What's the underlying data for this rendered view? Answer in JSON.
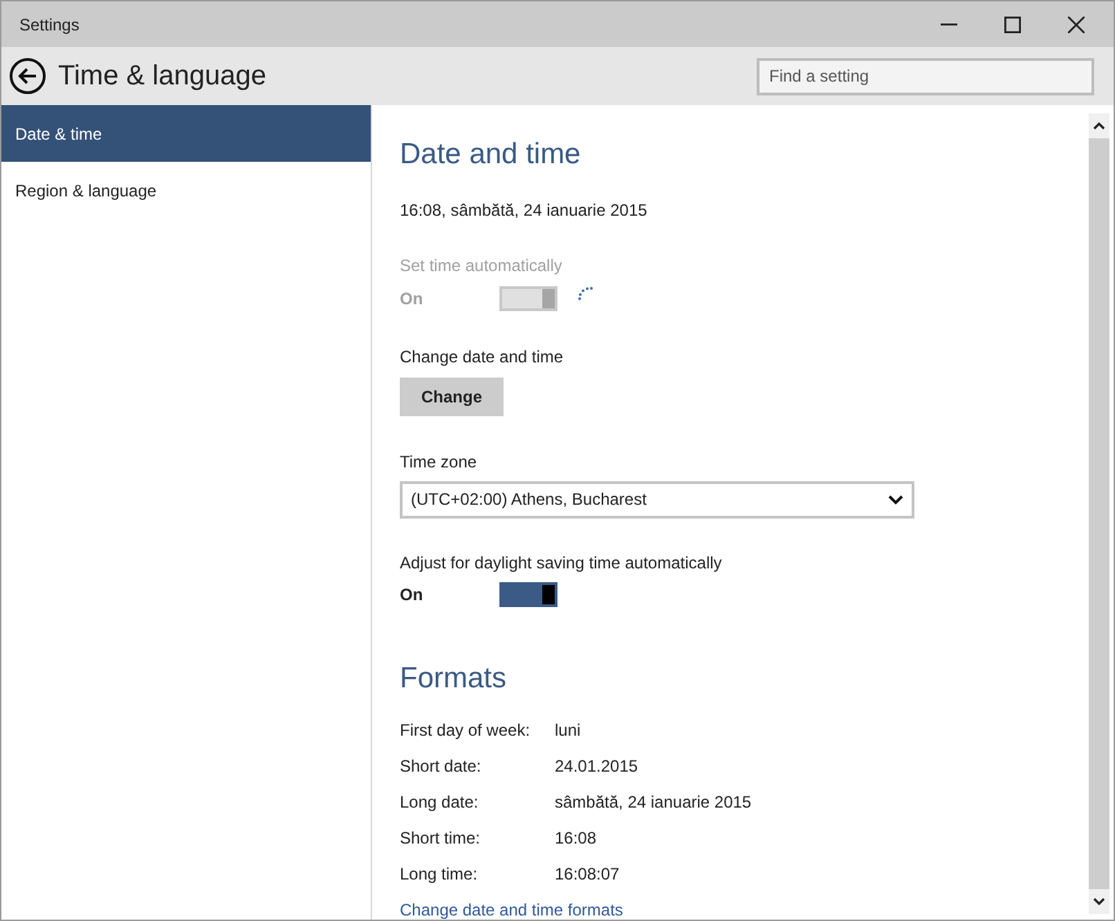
{
  "window": {
    "title": "Settings"
  },
  "header": {
    "title": "Time & language",
    "search": {
      "placeholder": "Find a setting"
    }
  },
  "sidebar": {
    "items": [
      {
        "label": "Date & time",
        "selected": true
      },
      {
        "label": "Region & language",
        "selected": false
      }
    ]
  },
  "date_and_time": {
    "heading": "Date and time",
    "current": "16:08, sâmbătă, 24 ianuarie 2015",
    "set_time_automatically": {
      "label": "Set time automatically",
      "state": "On",
      "on": true,
      "disabled": true,
      "busy": true
    },
    "change_date": {
      "label": "Change date and time",
      "button": "Change"
    },
    "time_zone": {
      "label": "Time zone",
      "value": "(UTC+02:00) Athens, Bucharest"
    },
    "daylight": {
      "label": "Adjust for daylight saving time automatically",
      "state": "On",
      "on": true,
      "disabled": false
    }
  },
  "formats": {
    "heading": "Formats",
    "rows": [
      {
        "label": "First day of week:",
        "value": "luni"
      },
      {
        "label": "Short date:",
        "value": "24.01.2015"
      },
      {
        "label": "Long date:",
        "value": "sâmbătă, 24 ianuarie 2015"
      },
      {
        "label": "Short time:",
        "value": "16:08"
      },
      {
        "label": "Long time:",
        "value": "16:08:07"
      }
    ],
    "link": "Change date and time formats"
  }
}
